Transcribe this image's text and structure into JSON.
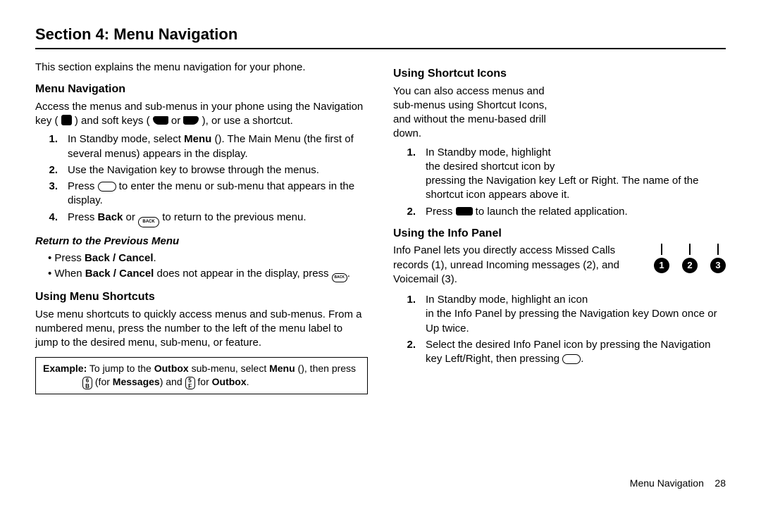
{
  "section_title": "Section 4: Menu Navigation",
  "intro": "This section explains the menu navigation for your phone.",
  "left": {
    "menu_nav_head": "Menu Navigation",
    "menu_nav_para_a": "Access the menus and sub-menus in your phone using the Navigation key (",
    "menu_nav_para_b": ") and soft keys (",
    "menu_nav_para_or": " or ",
    "menu_nav_para_c": "), or use a shortcut.",
    "step1a": "In Standby mode, select ",
    "step1_bold": "Menu",
    "step1b": " (",
    "step1c": "). The Main Menu (the first of several menus) appears in the display.",
    "step2": "Use the Navigation key to browse through the menus.",
    "step3a": "Press ",
    "step3b": " to enter the menu or sub-menu that appears in the display.",
    "step4a": "Press ",
    "step4_bold": "Back",
    "step4b": " or ",
    "step4c": " to return to the previous menu.",
    "return_head": "Return to the Previous Menu",
    "ret_b1a": "Press ",
    "ret_b1_bold": "Back / Cancel",
    "ret_b1b": ".",
    "ret_b2a": "When ",
    "ret_b2_bold": "Back / Cancel",
    "ret_b2b": " does not appear in the display, press ",
    "ret_b2c": ".",
    "shortcuts_head": "Using Menu Shortcuts",
    "shortcuts_para": "Use menu shortcuts to quickly access menus and sub-menus. From a numbered menu, press the number to the left of the menu label to jump to the desired menu, sub-menu, or feature.",
    "ex_label": "Example:",
    "ex_a": " To jump to the ",
    "ex_outbox": "Outbox",
    "ex_b": " sub-menu, select ",
    "ex_menu": "Menu",
    "ex_c": " (",
    "ex_d": "), then press ",
    "ex_for1a": "(for ",
    "ex_messages": "Messages",
    "ex_for1b": ") and ",
    "ex_for2a": " for ",
    "ex_for2b": ".",
    "key6_top": "6",
    "key6_sub": "B",
    "key5_top": "5",
    "key5_sub": "F"
  },
  "right": {
    "shortcut_icons_head": "Using Shortcut Icons",
    "shortcut_icons_para": "You can also access menus and sub-menus using Shortcut Icons, and without the menu-based drill down.",
    "si_step1a": "In Standby mode, highlight the desired shortcut icon by",
    "si_step1b": "pressing the Navigation key Left or Right. The name of the shortcut icon appears above it.",
    "si_step2a": "Press ",
    "si_step2b": " to launch the related application.",
    "info_head": "Using the Info Panel",
    "info_para": "Info Panel lets you directly access Missed Calls records (1), unread Incoming messages (2), and Voicemail (3).",
    "info_step1a": "In Standby mode, highlight an icon",
    "info_step1b": "in the Info Panel by pressing the Navigation key Down once or Up twice.",
    "info_step2a": "Select the desired Info Panel icon by pressing the Navigation key Left/Right, then pressing ",
    "info_step2b": ".",
    "info_icons": [
      "1",
      "2",
      "3"
    ]
  },
  "nums": {
    "n1": "1.",
    "n2": "2.",
    "n3": "3.",
    "n4": "4."
  },
  "footer": {
    "label": "Menu Navigation",
    "page": "28"
  }
}
